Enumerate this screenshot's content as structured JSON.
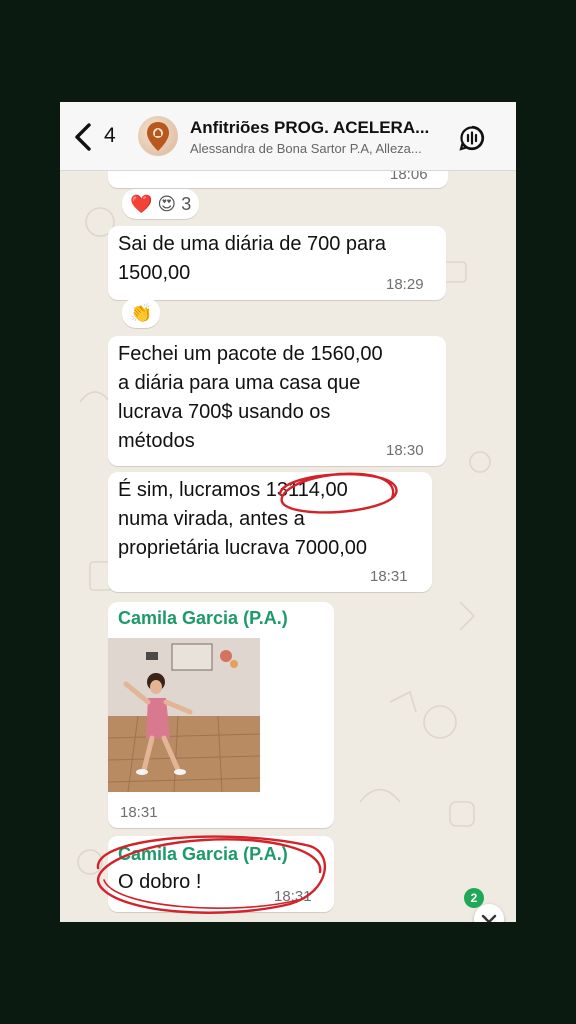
{
  "header": {
    "back_count": "4",
    "title": "Anfitriões PROG. ACELERA...",
    "subtitle": "Alessandra de Bona Sartor P.A, Alleza..."
  },
  "messages": [
    {
      "time": "18:06"
    },
    {
      "text": "Sai de uma diária de 700 para\n1500,00",
      "time": "18:29"
    },
    {
      "text": "Fechei um pacote de 1560,00\na diária para uma casa que\nlucrava 700$ usando os\nmétodos",
      "time": "18:30"
    },
    {
      "text": "É sim, lucramos 13114,00\nnuma virada, antes a\nproprietária lucrava 7000,00",
      "time": "18:31"
    },
    {
      "sender": "Camila Garcia (P.A.)",
      "time": "18:31"
    },
    {
      "sender": "Camila Garcia (P.A.)",
      "text": "O dobro !",
      "time": "18:31"
    }
  ],
  "reactions": [
    {
      "emojis": "❤️ 😍",
      "count": "3"
    },
    {
      "emojis": "👏"
    }
  ],
  "scroll_badge": "2",
  "colors": {
    "sender": "#1c9a6a",
    "annotation": "#d2232a",
    "badge": "#1fa855"
  }
}
